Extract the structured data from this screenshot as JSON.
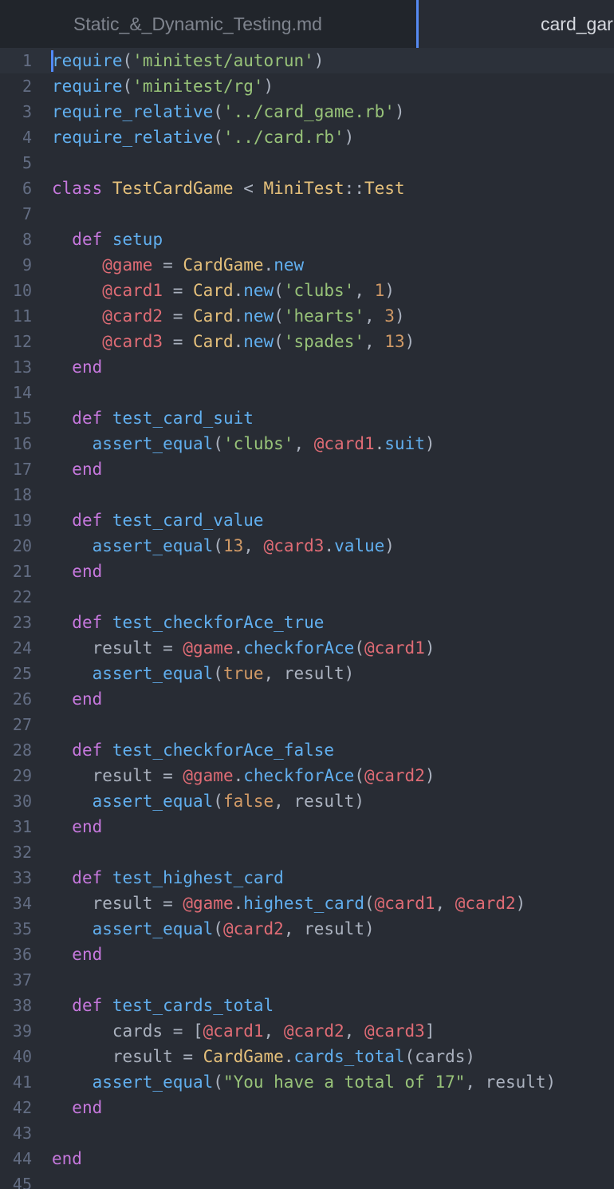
{
  "tabs": [
    {
      "label": "Static_&_Dynamic_Testing.md",
      "active": false
    },
    {
      "label": "card_gar",
      "active": true
    }
  ],
  "editor": {
    "lines": [
      [
        [
          "fn",
          "require"
        ],
        [
          "plain",
          "("
        ],
        [
          "str",
          "'minitest/autorun'"
        ],
        [
          "plain",
          ")"
        ]
      ],
      [
        [
          "fn",
          "require"
        ],
        [
          "plain",
          "("
        ],
        [
          "str",
          "'minitest/rg'"
        ],
        [
          "plain",
          ")"
        ]
      ],
      [
        [
          "fn",
          "require_relative"
        ],
        [
          "plain",
          "("
        ],
        [
          "str",
          "'../card_game.rb'"
        ],
        [
          "plain",
          ")"
        ]
      ],
      [
        [
          "fn",
          "require_relative"
        ],
        [
          "plain",
          "("
        ],
        [
          "str",
          "'../card.rb'"
        ],
        [
          "plain",
          ")"
        ]
      ],
      [],
      [
        [
          "kw",
          "class "
        ],
        [
          "const",
          "TestCardGame"
        ],
        [
          "plain",
          " < "
        ],
        [
          "const",
          "MiniTest"
        ],
        [
          "plain",
          "::"
        ],
        [
          "const",
          "Test"
        ]
      ],
      [],
      [
        [
          "plain",
          "  "
        ],
        [
          "kw",
          "def "
        ],
        [
          "fn",
          "setup"
        ]
      ],
      [
        [
          "plain",
          "     "
        ],
        [
          "ivar",
          "@game"
        ],
        [
          "plain",
          " = "
        ],
        [
          "const",
          "CardGame"
        ],
        [
          "plain",
          "."
        ],
        [
          "fn",
          "new"
        ]
      ],
      [
        [
          "plain",
          "     "
        ],
        [
          "ivar",
          "@card1"
        ],
        [
          "plain",
          " = "
        ],
        [
          "const",
          "Card"
        ],
        [
          "plain",
          "."
        ],
        [
          "fn",
          "new"
        ],
        [
          "plain",
          "("
        ],
        [
          "str",
          "'clubs'"
        ],
        [
          "plain",
          ", "
        ],
        [
          "num",
          "1"
        ],
        [
          "plain",
          ")"
        ]
      ],
      [
        [
          "plain",
          "     "
        ],
        [
          "ivar",
          "@card2"
        ],
        [
          "plain",
          " = "
        ],
        [
          "const",
          "Card"
        ],
        [
          "plain",
          "."
        ],
        [
          "fn",
          "new"
        ],
        [
          "plain",
          "("
        ],
        [
          "str",
          "'hearts'"
        ],
        [
          "plain",
          ", "
        ],
        [
          "num",
          "3"
        ],
        [
          "plain",
          ")"
        ]
      ],
      [
        [
          "plain",
          "     "
        ],
        [
          "ivar",
          "@card3"
        ],
        [
          "plain",
          " = "
        ],
        [
          "const",
          "Card"
        ],
        [
          "plain",
          "."
        ],
        [
          "fn",
          "new"
        ],
        [
          "plain",
          "("
        ],
        [
          "str",
          "'spades'"
        ],
        [
          "plain",
          ", "
        ],
        [
          "num",
          "13"
        ],
        [
          "plain",
          ")"
        ]
      ],
      [
        [
          "plain",
          "  "
        ],
        [
          "kw",
          "end"
        ]
      ],
      [],
      [
        [
          "plain",
          "  "
        ],
        [
          "kw",
          "def "
        ],
        [
          "fn",
          "test_card_suit"
        ]
      ],
      [
        [
          "plain",
          "    "
        ],
        [
          "fn",
          "assert_equal"
        ],
        [
          "plain",
          "("
        ],
        [
          "str",
          "'clubs'"
        ],
        [
          "plain",
          ", "
        ],
        [
          "ivar",
          "@card1"
        ],
        [
          "plain",
          "."
        ],
        [
          "fn",
          "suit"
        ],
        [
          "plain",
          ")"
        ]
      ],
      [
        [
          "plain",
          "  "
        ],
        [
          "kw",
          "end"
        ]
      ],
      [],
      [
        [
          "plain",
          "  "
        ],
        [
          "kw",
          "def "
        ],
        [
          "fn",
          "test_card_value"
        ]
      ],
      [
        [
          "plain",
          "    "
        ],
        [
          "fn",
          "assert_equal"
        ],
        [
          "plain",
          "("
        ],
        [
          "num",
          "13"
        ],
        [
          "plain",
          ", "
        ],
        [
          "ivar",
          "@card3"
        ],
        [
          "plain",
          "."
        ],
        [
          "fn",
          "value"
        ],
        [
          "plain",
          ")"
        ]
      ],
      [
        [
          "plain",
          "  "
        ],
        [
          "kw",
          "end"
        ]
      ],
      [],
      [
        [
          "plain",
          "  "
        ],
        [
          "kw",
          "def "
        ],
        [
          "fn",
          "test_checkforAce_true"
        ]
      ],
      [
        [
          "plain",
          "    result = "
        ],
        [
          "ivar",
          "@game"
        ],
        [
          "plain",
          "."
        ],
        [
          "fn",
          "checkforAce"
        ],
        [
          "plain",
          "("
        ],
        [
          "ivar",
          "@card1"
        ],
        [
          "plain",
          ")"
        ]
      ],
      [
        [
          "plain",
          "    "
        ],
        [
          "fn",
          "assert_equal"
        ],
        [
          "plain",
          "("
        ],
        [
          "num",
          "true"
        ],
        [
          "plain",
          ", result)"
        ]
      ],
      [
        [
          "plain",
          "  "
        ],
        [
          "kw",
          "end"
        ]
      ],
      [],
      [
        [
          "plain",
          "  "
        ],
        [
          "kw",
          "def "
        ],
        [
          "fn",
          "test_checkforAce_false"
        ]
      ],
      [
        [
          "plain",
          "    result = "
        ],
        [
          "ivar",
          "@game"
        ],
        [
          "plain",
          "."
        ],
        [
          "fn",
          "checkforAce"
        ],
        [
          "plain",
          "("
        ],
        [
          "ivar",
          "@card2"
        ],
        [
          "plain",
          ")"
        ]
      ],
      [
        [
          "plain",
          "    "
        ],
        [
          "fn",
          "assert_equal"
        ],
        [
          "plain",
          "("
        ],
        [
          "num",
          "false"
        ],
        [
          "plain",
          ", result)"
        ]
      ],
      [
        [
          "plain",
          "  "
        ],
        [
          "kw",
          "end"
        ]
      ],
      [],
      [
        [
          "plain",
          "  "
        ],
        [
          "kw",
          "def "
        ],
        [
          "fn",
          "test_highest_card"
        ]
      ],
      [
        [
          "plain",
          "    result = "
        ],
        [
          "ivar",
          "@game"
        ],
        [
          "plain",
          "."
        ],
        [
          "fn",
          "highest_card"
        ],
        [
          "plain",
          "("
        ],
        [
          "ivar",
          "@card1"
        ],
        [
          "plain",
          ", "
        ],
        [
          "ivar",
          "@card2"
        ],
        [
          "plain",
          ")"
        ]
      ],
      [
        [
          "plain",
          "    "
        ],
        [
          "fn",
          "assert_equal"
        ],
        [
          "plain",
          "("
        ],
        [
          "ivar",
          "@card2"
        ],
        [
          "plain",
          ", result)"
        ]
      ],
      [
        [
          "plain",
          "  "
        ],
        [
          "kw",
          "end"
        ]
      ],
      [],
      [
        [
          "plain",
          "  "
        ],
        [
          "kw",
          "def "
        ],
        [
          "fn",
          "test_cards_total"
        ]
      ],
      [
        [
          "plain",
          "      cards = ["
        ],
        [
          "ivar",
          "@card1"
        ],
        [
          "plain",
          ", "
        ],
        [
          "ivar",
          "@card2"
        ],
        [
          "plain",
          ", "
        ],
        [
          "ivar",
          "@card3"
        ],
        [
          "plain",
          "]"
        ]
      ],
      [
        [
          "plain",
          "      result = "
        ],
        [
          "const",
          "CardGame"
        ],
        [
          "plain",
          "."
        ],
        [
          "fn",
          "cards_total"
        ],
        [
          "plain",
          "(cards)"
        ]
      ],
      [
        [
          "plain",
          "    "
        ],
        [
          "fn",
          "assert_equal"
        ],
        [
          "plain",
          "("
        ],
        [
          "str",
          "\"You have a total of 17\""
        ],
        [
          "plain",
          ", result)"
        ]
      ],
      [
        [
          "plain",
          "  "
        ],
        [
          "kw",
          "end"
        ]
      ],
      [],
      [
        [
          "kw",
          "end"
        ]
      ],
      []
    ]
  }
}
